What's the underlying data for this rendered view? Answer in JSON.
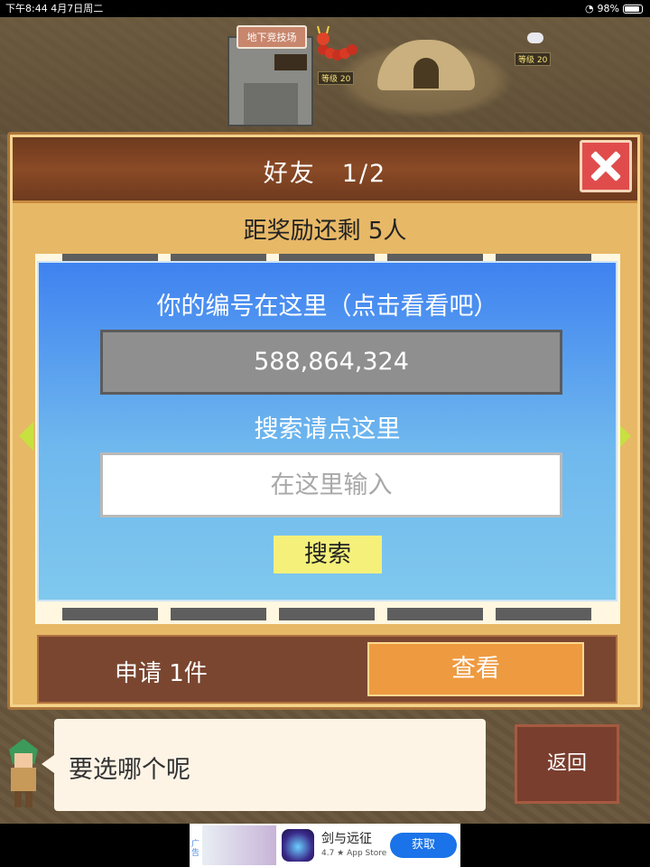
{
  "status_bar": {
    "time_date": "下午8:44  4月7日周二",
    "battery": "98%"
  },
  "scene": {
    "arena_sign": "地下竞技场",
    "monster_level_1": "等级 20",
    "monster_level_2": "等级 20"
  },
  "panel": {
    "title": "好友　1/2",
    "reward_text": "距奖励还剩 5人",
    "id_label": "你的编号在这里（点击看看吧）",
    "id_value": "588,864,324",
    "search_label": "搜索请点这里",
    "search_placeholder": "在这里输入",
    "search_button": "搜索",
    "request_text": "申请 1件",
    "view_button": "查看"
  },
  "dialog": {
    "text": "要选哪个呢",
    "back_button": "返回"
  },
  "ad": {
    "tag": "广告",
    "app_name": "剑与远征",
    "app_meta": "4.7 ★ App Store",
    "get_button": "获取"
  },
  "colors": {
    "panel_bg": "#e7b866",
    "title_bar": "#8a4a26",
    "blue_top": "#3f82f0",
    "blue_bottom": "#7fc8ee",
    "view_button": "#ee9a40",
    "search_button": "#f4f07a",
    "close_button": "#e04c4c"
  }
}
